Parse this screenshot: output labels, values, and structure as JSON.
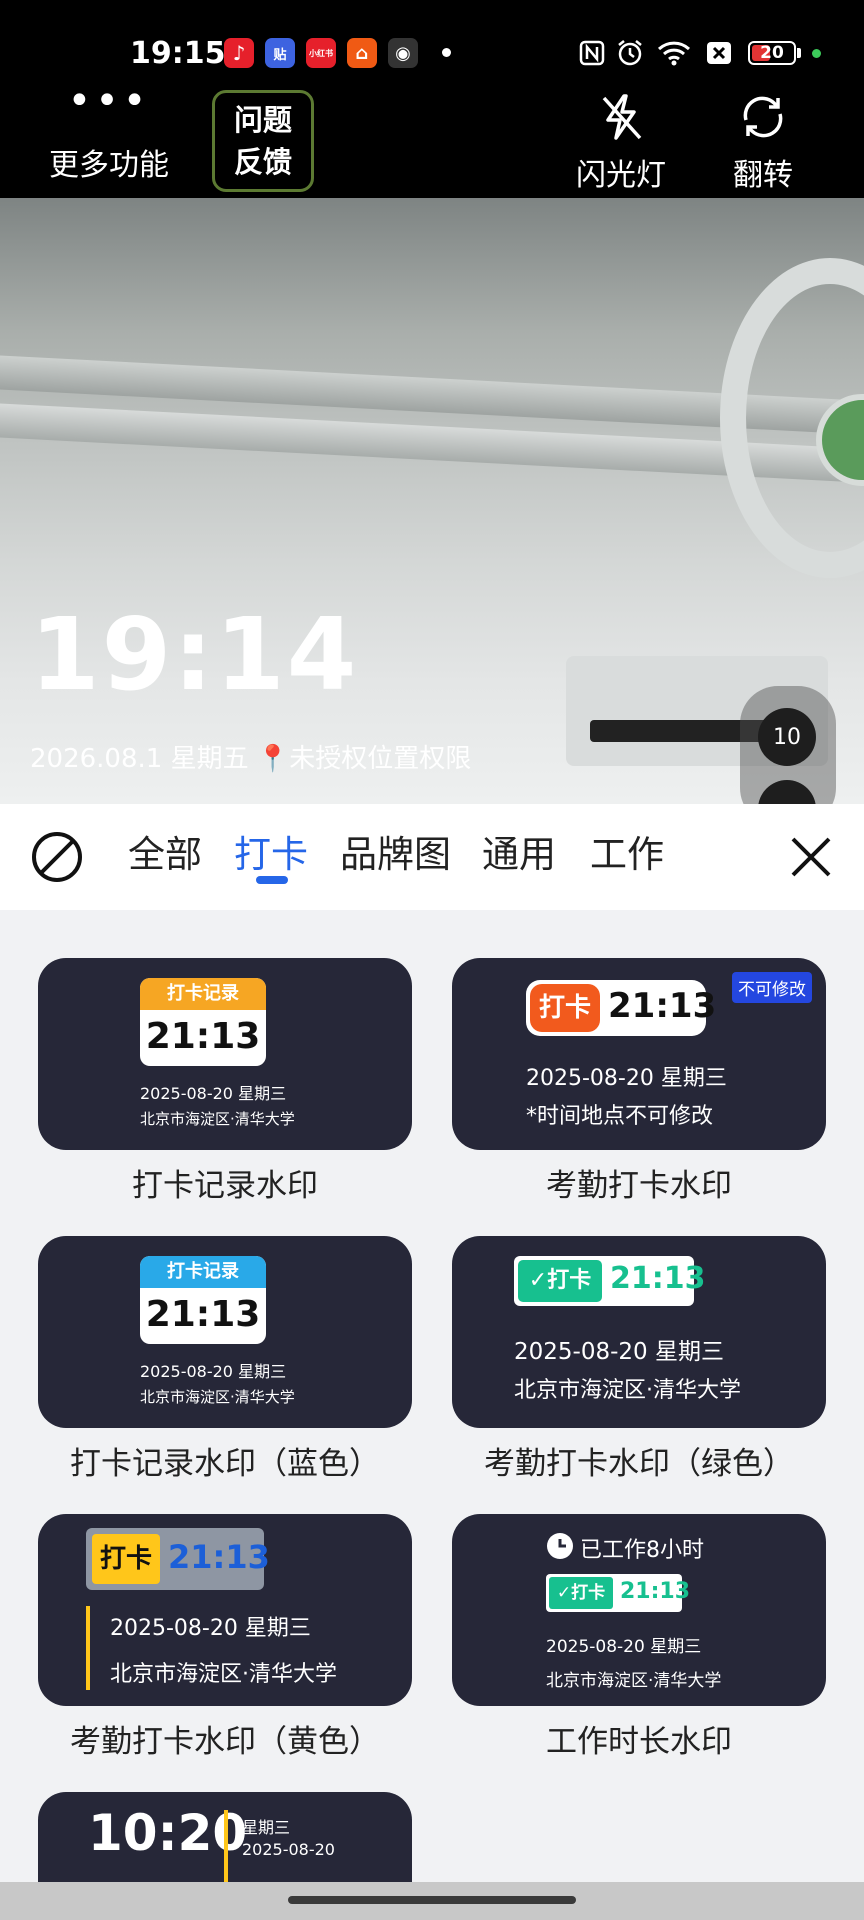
{
  "status_bar": {
    "time": "19:15",
    "app_icons": [
      {
        "name": "music-app-icon",
        "glyph": "♪",
        "color": "#e6202b"
      },
      {
        "name": "sticker-app-icon",
        "glyph": "贴",
        "color": "#3d63e0"
      },
      {
        "name": "xiaohongshu-app-icon",
        "glyph": "小红书",
        "color": "#e6202b"
      },
      {
        "name": "store-app-icon",
        "glyph": "⌂",
        "color": "#f05a14"
      },
      {
        "name": "camera-app-icon",
        "glyph": "◉",
        "color": "#202020"
      }
    ],
    "battery_level": "20",
    "battery_fraction": 0.2
  },
  "toolbar": {
    "more_label": "更多功能",
    "feedback_line1": "问题",
    "feedback_line2": "反馈",
    "flash_label": "闪光灯",
    "flip_label": "翻转"
  },
  "viewfinder": {
    "time": "19:14",
    "date_line": "2026.08.1 星期五 📍未授权位置权限",
    "count": "10"
  },
  "tabs": {
    "items": [
      "全部",
      "打卡",
      "品牌图",
      "通用",
      "工作"
    ],
    "active_index": 1
  },
  "cards": {
    "c1": {
      "head": "打卡记录",
      "time": "21:13",
      "date": "2025-08-20 星期三",
      "place": "北京市海淀区·清华大学",
      "caption": "打卡记录水印",
      "head_color": "#f6a623"
    },
    "c2": {
      "badge": "打卡",
      "time": "21:13",
      "date": "2025-08-20 星期三",
      "note": "*时间地点不可修改",
      "tag": "不可修改",
      "caption": "考勤打卡水印"
    },
    "c3": {
      "head": "打卡记录",
      "time": "21:13",
      "date": "2025-08-20 星期三",
      "place": "北京市海淀区·清华大学",
      "caption": "打卡记录水印（蓝色）",
      "head_color": "#29a9e8"
    },
    "c4": {
      "badge": "打卡",
      "time": "21:13",
      "date": "2025-08-20 星期三",
      "place": "北京市海淀区·清华大学",
      "caption": "考勤打卡水印（绿色）"
    },
    "c5": {
      "badge": "打卡",
      "time": "21:13",
      "date": "2025-08-20 星期三",
      "place": "北京市海淀区·清华大学",
      "caption": "考勤打卡水印（黄色）"
    },
    "c6": {
      "worked": "已工作8小时",
      "badge": "打卡",
      "time": "21:13",
      "date": "2025-08-20 星期三",
      "place": "北京市海淀区·清华大学",
      "caption": "工作时长水印"
    },
    "c7": {
      "time": "10:20",
      "weekday": "星期三",
      "date": "2025-08-20"
    }
  }
}
